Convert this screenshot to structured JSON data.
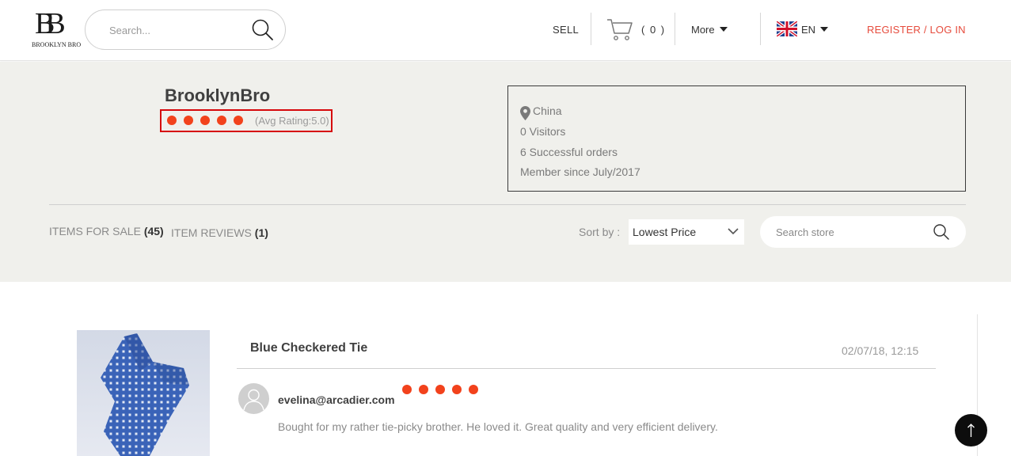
{
  "header": {
    "logo_text": "BROOKLYN BRO",
    "logo_mark": "BB",
    "search_placeholder": "Search...",
    "sell_label": "SELL",
    "cart_count": "( 0 )",
    "more_label": "More",
    "language": "EN",
    "register_label": "REGISTER / LOG IN",
    "accent_color": "#e64b3c"
  },
  "seller": {
    "name": "BrooklynBro",
    "rating": 5,
    "avg_rating_label": "(Avg Rating:5.0)",
    "location": "China",
    "visitors": "0 Visitors",
    "orders": "6 Successful orders",
    "member_since": "Member since July/2017",
    "rating_color": "#f2421c"
  },
  "tabs": [
    {
      "label": "ITEMS FOR SALE",
      "count": "(45)"
    },
    {
      "label": "ITEM REVIEWS",
      "count": "(1)"
    }
  ],
  "sort": {
    "label": "Sort by :",
    "selected": "Lowest Price"
  },
  "store_search": {
    "placeholder": "Search store"
  },
  "review": {
    "item_title": "Blue Checkered Tie",
    "date": "02/07/18, 12:15",
    "reviewer": "evelina@arcadier.com",
    "rating": 5,
    "text": "Bought for my rather tie-picky brother. He loved it. Great quality and very efficient delivery."
  },
  "icons": {
    "search": "search-icon",
    "cart": "cart-icon",
    "flag": "uk-flag-icon",
    "location": "location-pin-icon",
    "scroll_top": "arrow-up-icon"
  }
}
